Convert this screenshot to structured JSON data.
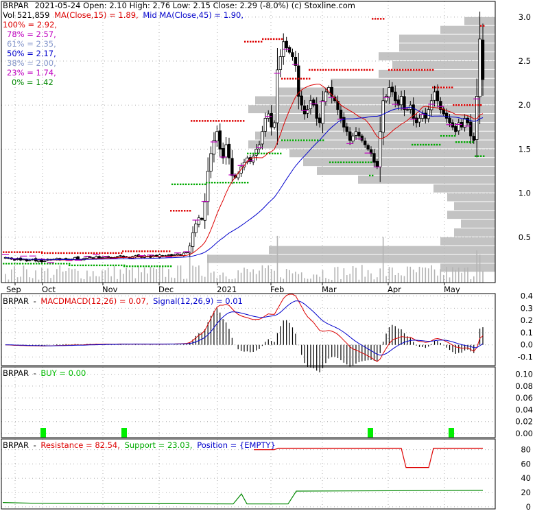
{
  "header": {
    "line1_ticker": "BRPAR",
    "line1_rest": "2021-05-24 Open: 2.10  High: 2.76  Low: 2.15  Close: 2.29 (-8.0%)  (c) Stoxline.com",
    "vol": "Vol 521,859",
    "ma15": "MA(Close,15) = 1.89,",
    "ma45": "Mid MA(Close,45) = 1.90,"
  },
  "colors": {
    "red": "#dd0000",
    "blue": "#0000cc",
    "green": "#00aa00",
    "grid": "#aaaaaa",
    "volume": "#b4b4b4",
    "profile": "#b9b9b9",
    "magenta": "#c000c0",
    "candle": "#000000"
  },
  "fib_levels": [
    {
      "label": "100% = 2.92,",
      "color": "#dd0000"
    },
    {
      "label": "78% = 2.57,",
      "color": "#c000c0"
    },
    {
      "label": "61% = 2.35,",
      "color": "#8899cc"
    },
    {
      "label": "50% = 2.17,",
      "color": "#0000cc"
    },
    {
      "label": "38% = 2.00,",
      "color": "#8899cc"
    },
    {
      "label": "23% = 1.74,",
      "color": "#c000c0"
    },
    {
      "label": "0% = 1.42",
      "color": "#008800"
    }
  ],
  "macd_panel": {
    "ticker": "BRPAR",
    "label": "MACDMACD(12,26) = 0.07,",
    "signal": "Signal(12,26,9) = 0.01"
  },
  "buy_panel": {
    "ticker": "BRPAR",
    "label": "BUY = 0.00"
  },
  "res_panel": {
    "ticker": "BRPAR",
    "resistance": "Resistance = 82.54,",
    "support": "Support = 23.03,",
    "position": "Position = {EMPTY}"
  },
  "chart_data": [
    {
      "type": "candlestick",
      "panel": "price",
      "x_labels": [
        "Sep",
        "Oct",
        "Nov",
        "Dec",
        "2021",
        "Feb",
        "Mar",
        "Apr",
        "May"
      ],
      "y_ticks": [
        "3.0",
        "2.5",
        "2.0",
        "1.5",
        "1.0",
        "0.5"
      ],
      "ylim": [
        0.0,
        3.1
      ],
      "close_series": [
        0.27,
        0.26,
        0.25,
        0.24,
        0.26,
        0.24,
        0.25,
        0.23,
        0.24,
        0.25,
        0.23,
        0.24,
        0.22,
        0.23,
        0.25,
        0.24,
        0.25,
        0.26,
        0.24,
        0.25,
        0.26,
        0.24,
        0.25,
        0.27,
        0.25,
        0.24,
        0.26,
        0.28,
        0.27,
        0.26,
        0.28,
        0.26,
        0.27,
        0.28,
        0.27,
        0.26,
        0.27,
        0.28,
        0.29,
        0.27,
        0.28,
        0.27,
        0.28,
        0.29,
        0.28,
        0.27,
        0.29,
        0.28,
        0.27,
        0.29,
        0.28,
        0.3,
        0.28,
        0.29,
        0.3,
        0.29,
        0.3,
        0.31,
        0.3,
        0.32,
        0.33,
        0.4,
        0.55,
        0.65,
        0.72,
        0.7,
        0.9,
        1.25,
        1.45,
        1.6,
        1.7,
        1.5,
        1.4,
        1.55,
        1.4,
        1.2,
        1.18,
        1.22,
        1.3,
        1.35,
        1.4,
        1.36,
        1.42,
        1.5,
        1.55,
        1.7,
        1.85,
        1.9,
        1.75,
        1.8,
        2.4,
        2.55,
        2.72,
        2.65,
        2.6,
        2.55,
        2.45,
        2.1,
        2.0,
        1.9,
        1.95,
        2.05,
        2.0,
        1.85,
        1.8,
        2.05,
        2.15,
        2.2,
        2.1,
        2.05,
        1.95,
        1.85,
        1.75,
        1.7,
        1.6,
        1.65,
        1.7,
        1.65,
        1.6,
        1.55,
        1.5,
        1.45,
        1.35,
        1.3,
        1.7,
        2.05,
        2.1,
        2.2,
        2.15,
        2.05,
        2.0,
        2.1,
        1.95,
        1.95,
        2.0,
        1.85,
        1.8,
        1.85,
        1.9,
        1.85,
        1.95,
        2.05,
        2.15,
        2.05,
        1.95,
        1.9,
        1.85,
        1.8,
        1.75,
        1.7,
        1.8,
        1.75,
        1.85,
        1.8,
        1.65,
        1.6,
        2.1,
        2.75,
        2.29
      ]
    },
    {
      "type": "line",
      "panel": "macd",
      "y_ticks": [
        "0.4",
        "0.3",
        "0.2",
        "0.1",
        "0.0",
        "-0.1"
      ],
      "ylim": [
        -0.17,
        0.42
      ]
    },
    {
      "type": "bar",
      "panel": "buy",
      "y_ticks": [
        "0.10",
        "0.08",
        "0.06",
        "0.04",
        "0.02",
        "0.00"
      ],
      "ylim": [
        0.0,
        0.11
      ]
    },
    {
      "type": "line",
      "panel": "resistance-support",
      "y_ticks": [
        "80",
        "60",
        "40",
        "20",
        "0"
      ],
      "ylim": [
        -3,
        95
      ]
    }
  ]
}
